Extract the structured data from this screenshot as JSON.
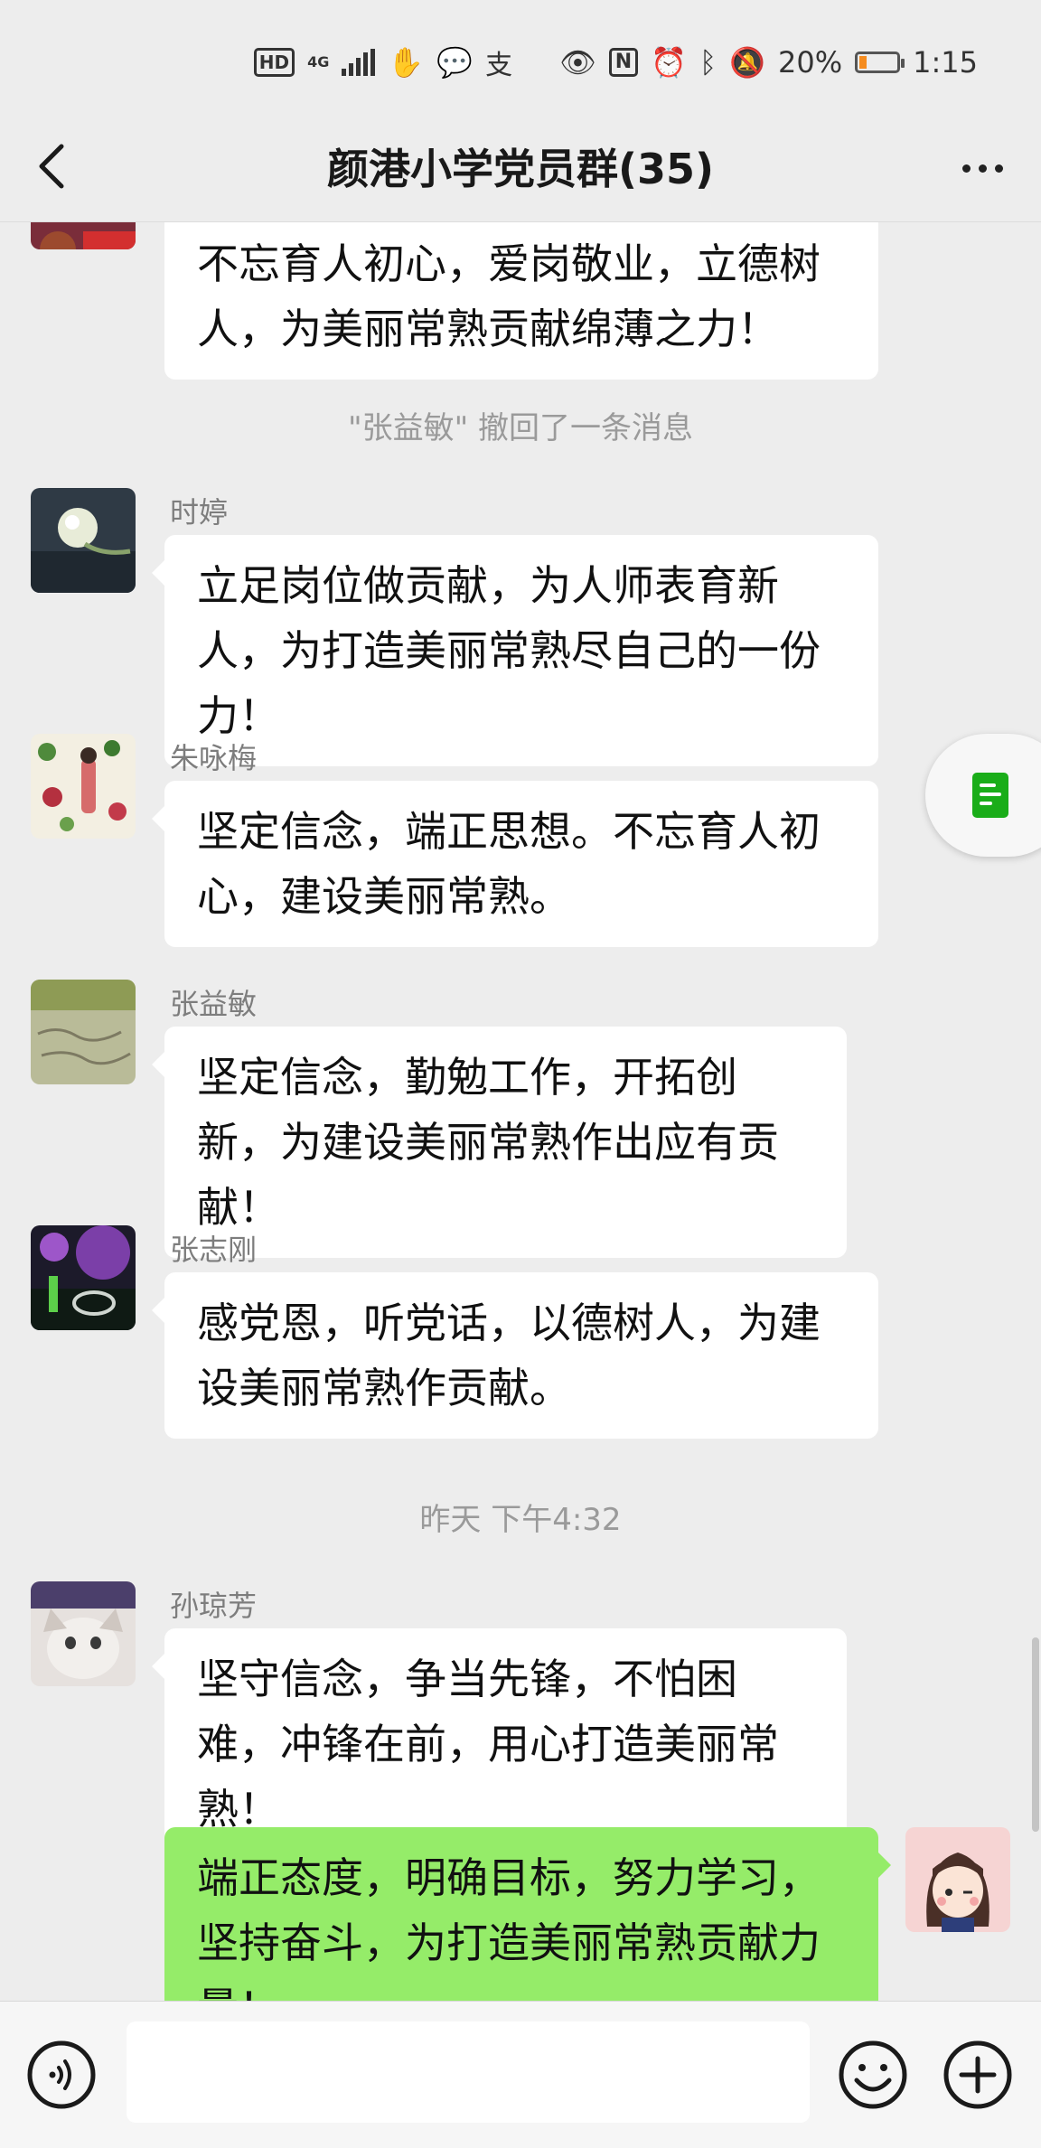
{
  "status": {
    "signal_label": "4G",
    "battery_text": "20%",
    "battery_level": 0.2,
    "time": "1:15"
  },
  "header": {
    "title": "颜港小学党员群(35)"
  },
  "messages": [
    {
      "type": "text",
      "text": "不忘育人初心，爱岗敬业，立德树人，为美丽常熟贡献绵薄之力！"
    },
    {
      "type": "notice",
      "text": "\"张益敏\" 撤回了一条消息"
    },
    {
      "type": "text",
      "sender": "时婷",
      "text": "立足岗位做贡献，为人师表育新人，为打造美丽常熟尽自己的一份力！"
    },
    {
      "type": "text",
      "sender": "朱咏梅",
      "text": "坚定信念，端正思想。不忘育人初心，建设美丽常熟。"
    },
    {
      "type": "text",
      "sender": "张益敏",
      "text": "坚定信念，勤勉工作，开拓创新，为建设美丽常熟作出应有贡献！"
    },
    {
      "type": "text",
      "sender": "张志刚",
      "text": "感党恩，听党话，以德树人，为建设美丽常熟作贡献。"
    },
    {
      "type": "time",
      "text": "昨天 下午4:32"
    },
    {
      "type": "text",
      "sender": "孙琼芳",
      "text": "坚守信念，争当先锋，不怕困难，冲锋在前，用心打造美丽常熟！"
    },
    {
      "type": "text",
      "mine": true,
      "text": "端正态度，明确目标，努力学习，坚持奋斗，为打造美丽常熟贡献力量！"
    }
  ],
  "input": {
    "value": "",
    "placeholder": ""
  },
  "colors": {
    "background": "#ededed",
    "incoming_bubble": "#ffffff",
    "outgoing_bubble": "#95ec69",
    "accent": "#1aad19",
    "battery": "#f58c1f"
  }
}
